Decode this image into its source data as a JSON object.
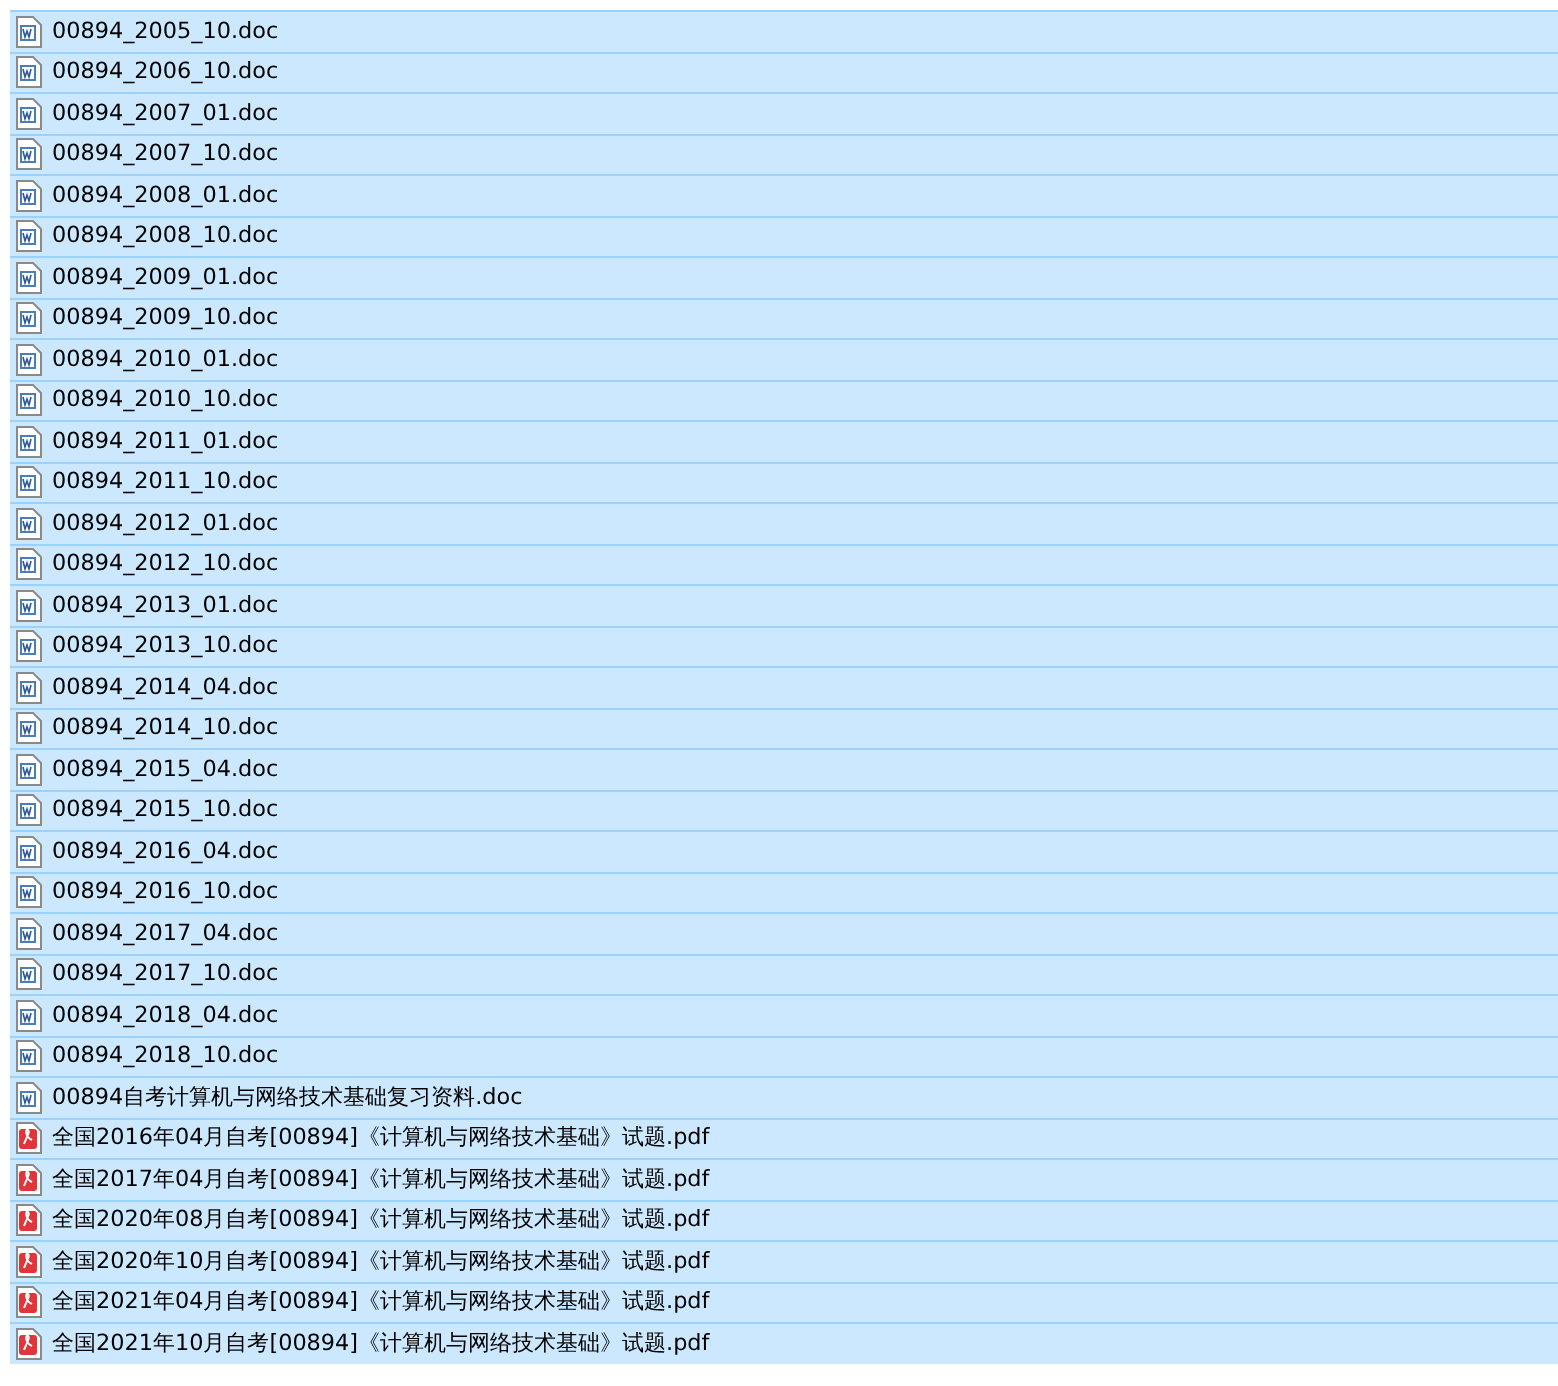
{
  "files": [
    {
      "name": "00894_2005_10.doc",
      "kind": "doc",
      "selected": true
    },
    {
      "name": "00894_2006_10.doc",
      "kind": "doc",
      "selected": true
    },
    {
      "name": "00894_2007_01.doc",
      "kind": "doc",
      "selected": true
    },
    {
      "name": "00894_2007_10.doc",
      "kind": "doc",
      "selected": true
    },
    {
      "name": "00894_2008_01.doc",
      "kind": "doc",
      "selected": true
    },
    {
      "name": "00894_2008_10.doc",
      "kind": "doc",
      "selected": true
    },
    {
      "name": "00894_2009_01.doc",
      "kind": "doc",
      "selected": true
    },
    {
      "name": "00894_2009_10.doc",
      "kind": "doc",
      "selected": true
    },
    {
      "name": "00894_2010_01.doc",
      "kind": "doc",
      "selected": true
    },
    {
      "name": "00894_2010_10.doc",
      "kind": "doc",
      "selected": true
    },
    {
      "name": "00894_2011_01.doc",
      "kind": "doc",
      "selected": true
    },
    {
      "name": "00894_2011_10.doc",
      "kind": "doc",
      "selected": true
    },
    {
      "name": "00894_2012_01.doc",
      "kind": "doc",
      "selected": true
    },
    {
      "name": "00894_2012_10.doc",
      "kind": "doc",
      "selected": true
    },
    {
      "name": "00894_2013_01.doc",
      "kind": "doc",
      "selected": true
    },
    {
      "name": "00894_2013_10.doc",
      "kind": "doc",
      "selected": true
    },
    {
      "name": "00894_2014_04.doc",
      "kind": "doc",
      "selected": true
    },
    {
      "name": "00894_2014_10.doc",
      "kind": "doc",
      "selected": true
    },
    {
      "name": "00894_2015_04.doc",
      "kind": "doc",
      "selected": true
    },
    {
      "name": "00894_2015_10.doc",
      "kind": "doc",
      "selected": true
    },
    {
      "name": "00894_2016_04.doc",
      "kind": "doc",
      "selected": true
    },
    {
      "name": "00894_2016_10.doc",
      "kind": "doc",
      "selected": true
    },
    {
      "name": "00894_2017_04.doc",
      "kind": "doc",
      "selected": true
    },
    {
      "name": "00894_2017_10.doc",
      "kind": "doc",
      "selected": true
    },
    {
      "name": "00894_2018_04.doc",
      "kind": "doc",
      "selected": true
    },
    {
      "name": "00894_2018_10.doc",
      "kind": "doc",
      "selected": true
    },
    {
      "name": "00894自考计算机与网络技术基础复习资料.doc",
      "kind": "doc",
      "selected": true
    },
    {
      "name": "全国2016年04月自考[00894]《计算机与网络技术基础》试题.pdf",
      "kind": "pdf",
      "selected": true
    },
    {
      "name": "全国2017年04月自考[00894]《计算机与网络技术基础》试题.pdf",
      "kind": "pdf",
      "selected": true
    },
    {
      "name": "全国2020年08月自考[00894]《计算机与网络技术基础》试题.pdf",
      "kind": "pdf",
      "selected": true
    },
    {
      "name": "全国2020年10月自考[00894]《计算机与网络技术基础》试题.pdf",
      "kind": "pdf",
      "selected": true
    },
    {
      "name": "全国2021年04月自考[00894]《计算机与网络技术基础》试题.pdf",
      "kind": "pdf",
      "selected": true
    },
    {
      "name": "全国2021年10月自考[00894]《计算机与网络技术基础》试题.pdf",
      "kind": "pdf",
      "selected": true
    }
  ]
}
